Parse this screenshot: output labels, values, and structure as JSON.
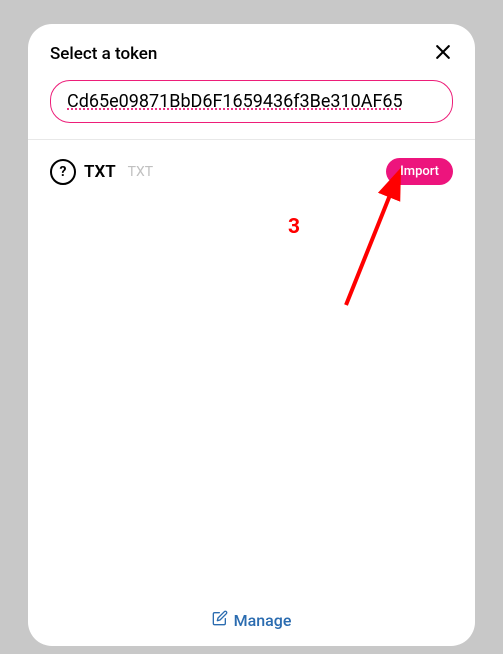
{
  "modal": {
    "title": "Select a token",
    "search": {
      "value": "Cd65e09871BbD6F1659436f3Be310AF65"
    },
    "tokens": [
      {
        "symbol": "TXT",
        "name": "TXT",
        "importLabel": "Import"
      }
    ],
    "manageLabel": "Manage"
  },
  "annotation": {
    "number": "3"
  },
  "colors": {
    "accent": "#ed147d",
    "link": "#2b6cb0"
  }
}
